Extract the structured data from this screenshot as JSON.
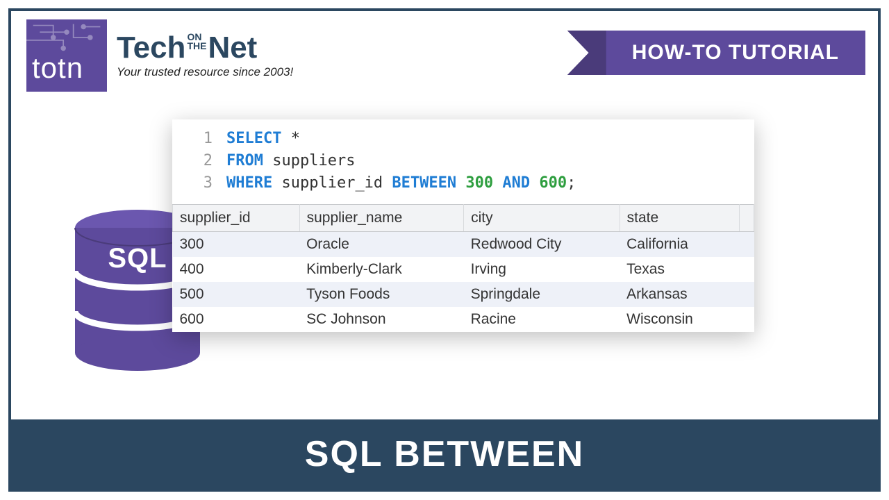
{
  "logo": {
    "badge_text": "totn",
    "brand_left": "Tech",
    "brand_mid_top": "ON",
    "brand_mid_bot": "THE",
    "brand_right": "Net",
    "tagline": "Your trusted resource since 2003!"
  },
  "ribbon": {
    "text": "HOW-TO TUTORIAL"
  },
  "code": {
    "lines": [
      {
        "n": "1",
        "tokens": [
          {
            "cls": "kw-blue",
            "t": "SELECT"
          },
          {
            "cls": "plain",
            "t": " "
          },
          {
            "cls": "star",
            "t": "*"
          }
        ]
      },
      {
        "n": "2",
        "tokens": [
          {
            "cls": "kw-blue",
            "t": "FROM"
          },
          {
            "cls": "plain",
            "t": " suppliers"
          }
        ]
      },
      {
        "n": "3",
        "tokens": [
          {
            "cls": "kw-blue",
            "t": "WHERE"
          },
          {
            "cls": "plain",
            "t": " supplier_id "
          },
          {
            "cls": "kw-blue",
            "t": "BETWEEN"
          },
          {
            "cls": "plain",
            "t": " "
          },
          {
            "cls": "kw-green",
            "t": "300"
          },
          {
            "cls": "plain",
            "t": " "
          },
          {
            "cls": "kw-blue",
            "t": "AND"
          },
          {
            "cls": "plain",
            "t": " "
          },
          {
            "cls": "kw-green",
            "t": "600"
          },
          {
            "cls": "plain",
            "t": ";"
          }
        ]
      }
    ]
  },
  "table": {
    "headers": [
      "supplier_id",
      "supplier_name",
      "city",
      "state"
    ],
    "rows": [
      [
        "300",
        "Oracle",
        "Redwood City",
        "California"
      ],
      [
        "400",
        "Kimberly-Clark",
        "Irving",
        "Texas"
      ],
      [
        "500",
        "Tyson Foods",
        "Springdale",
        "Arkansas"
      ],
      [
        "600",
        "SC Johnson",
        "Racine",
        "Wisconsin"
      ]
    ]
  },
  "db": {
    "label": "SQL"
  },
  "footer": {
    "title": "SQL BETWEEN"
  }
}
